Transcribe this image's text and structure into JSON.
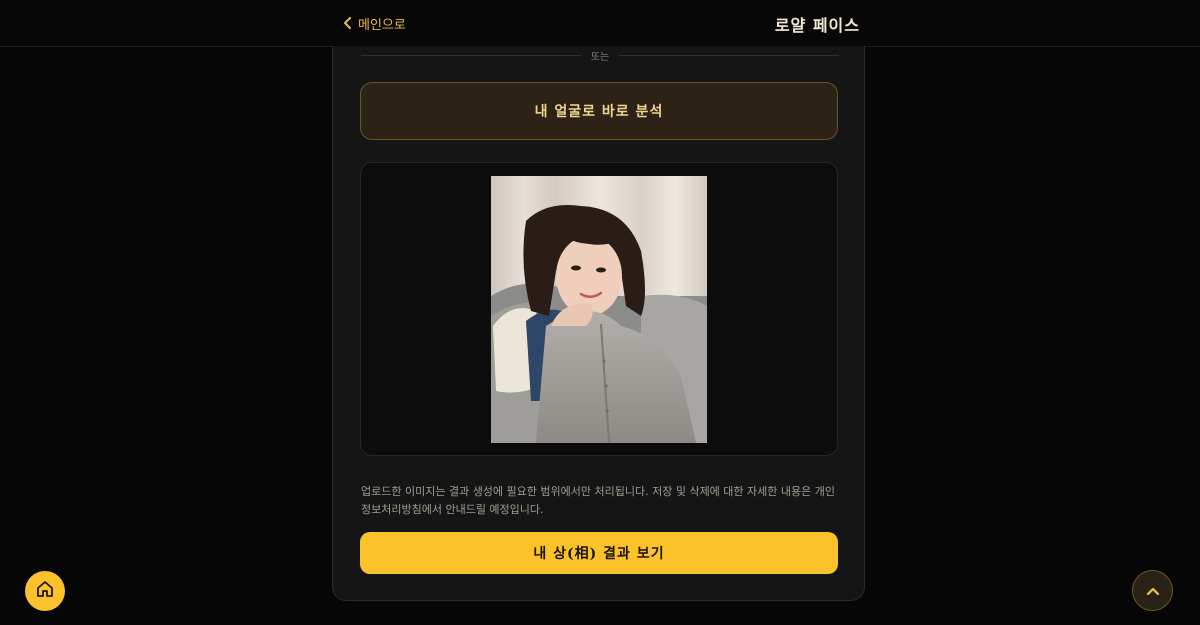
{
  "header": {
    "back_label": "메인으로",
    "brand": "로얄 페이스"
  },
  "divider_text": "또는",
  "analyze_button_label": "내 얼굴로 바로 분석",
  "preview": {
    "image": "portrait-photo"
  },
  "notice": "업로드한 이미지는 결과 생성에 필요한 범위에서만 처리됩니다. 저장 및 삭제에 대한 자세한 내용은 개인정보처리방침에서 안내드릴 예정입니다.",
  "result_button_label": "내 상(相) 결과 보기",
  "icons": {
    "back": "chevron-left-icon",
    "home": "home-icon",
    "scroll_top": "chevron-up-icon"
  },
  "colors": {
    "accent": "#fbc22a",
    "accent_text": "#e9be45",
    "background": "#060606",
    "panel": "#151515"
  }
}
